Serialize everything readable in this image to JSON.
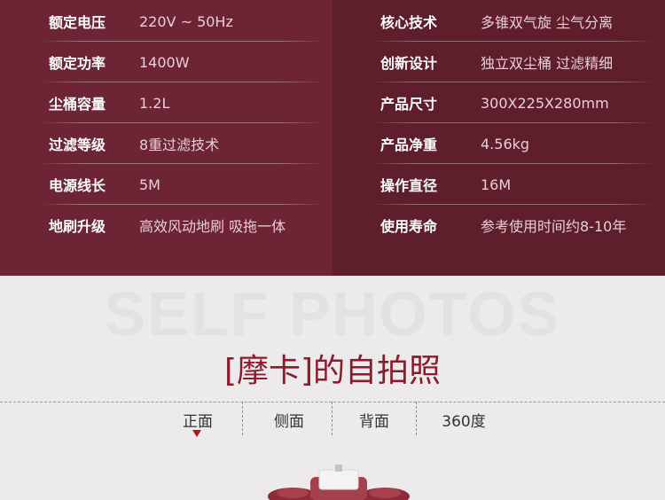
{
  "specs": {
    "left": [
      {
        "key": "额定电压",
        "value": "220V ~ 50Hz"
      },
      {
        "key": "额定功率",
        "value": "1400W"
      },
      {
        "key": "尘桶容量",
        "value": "1.2L"
      },
      {
        "key": "过滤等级",
        "value": "8重过滤技术"
      },
      {
        "key": "电源线长",
        "value": "5M"
      },
      {
        "key": "地刷升级",
        "value": "高效风动地刷 吸拖一体"
      }
    ],
    "right": [
      {
        "key": "核心技术",
        "value": "多锥双气旋 尘气分离"
      },
      {
        "key": "创新设计",
        "value": "独立双尘桶 过滤精细"
      },
      {
        "key": "产品尺寸",
        "value": "300X225X280mm"
      },
      {
        "key": "产品净重",
        "value": "4.56kg"
      },
      {
        "key": "操作直径",
        "value": "16M"
      },
      {
        "key": "使用寿命",
        "value": "参考使用时间约8-10年"
      }
    ]
  },
  "photos": {
    "watermark": "SELF PHOTOS",
    "heading": "[摩卡]的自拍照",
    "tabs": [
      "正面",
      "侧面",
      "背面",
      "360度"
    ],
    "active_tab": "正面"
  },
  "colors": {
    "panel_left": "#6d2435",
    "panel_right": "#5e1e2c",
    "accent": "#8e1b2c",
    "caret": "#b0151d"
  }
}
